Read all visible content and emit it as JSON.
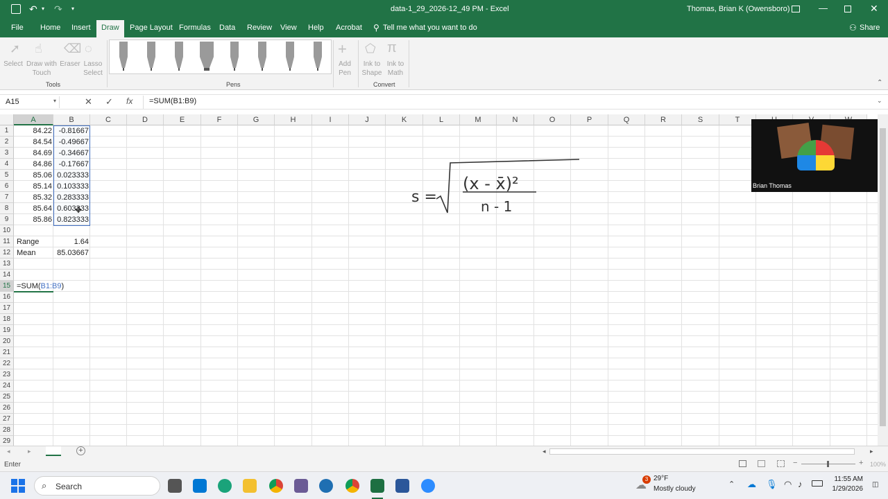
{
  "window": {
    "title": "data-1_29_2026-12_49 PM  -  Excel",
    "user": "Thomas, Brian K (Owensboro)"
  },
  "ribbon_tabs": [
    "File",
    "Home",
    "Insert",
    "Draw",
    "Page Layout",
    "Formulas",
    "Data",
    "Review",
    "View",
    "Help",
    "Acrobat"
  ],
  "tell_me": "Tell me what you want to do",
  "share": "Share",
  "ribbon": {
    "tools": {
      "select": "Select",
      "draw_touch": "Draw with Touch",
      "eraser": "Eraser",
      "lasso": "Lasso Select",
      "group": "Tools"
    },
    "pens_group": "Pens",
    "add_pen": "Add Pen",
    "ink_shape": "Ink to Shape",
    "ink_math": "Ink to Math",
    "convert_group": "Convert"
  },
  "formula_bar": {
    "name_box": "A15",
    "formula": "=SUM(B1:B9)",
    "fx": "fx"
  },
  "columns": [
    "A",
    "B",
    "C",
    "D",
    "E",
    "F",
    "G",
    "H",
    "I",
    "J",
    "K",
    "L",
    "M",
    "N",
    "O",
    "P",
    "Q",
    "R",
    "S",
    "T",
    "U",
    "V",
    "W"
  ],
  "rows": [
    "1",
    "2",
    "3",
    "4",
    "5",
    "6",
    "7",
    "8",
    "9",
    "10",
    "11",
    "12",
    "13",
    "14",
    "15",
    "16",
    "17",
    "18",
    "19",
    "20",
    "21",
    "22",
    "23",
    "24",
    "25",
    "26",
    "27",
    "28",
    "29"
  ],
  "cells": {
    "A": [
      "84.22",
      "84.54",
      "84.69",
      "84.86",
      "85.06",
      "85.14",
      "85.32",
      "85.64",
      "85.86"
    ],
    "B": [
      "-0.81667",
      "-0.49667",
      "-0.34667",
      "-0.17667",
      "0.023333",
      "0.103333",
      "0.283333",
      "0.603333",
      "0.823333"
    ],
    "range_label": "Range",
    "range_value": "1.64",
    "mean_label": "Mean",
    "mean_value": "85.03667",
    "a15_prefix": "=SUM(",
    "a15_ref": "B1:B9",
    "a15_suffix": ")"
  },
  "handwritten": {
    "lhs": "s =",
    "numerator": "(x - x̄)²",
    "denominator": "n - 1"
  },
  "video": {
    "name": "Brian Thomas"
  },
  "status": {
    "mode": "Enter",
    "zoom": "100%"
  },
  "taskbar": {
    "search": "Search",
    "weather_temp": "29°F",
    "weather_desc": "Mostly cloudy",
    "weather_badge": "3",
    "time": "11:55 AM",
    "date": "1/29/2026"
  },
  "colors": {
    "excel_green": "#217346",
    "selection": "#217346",
    "ref_blue": "#4472c4"
  }
}
